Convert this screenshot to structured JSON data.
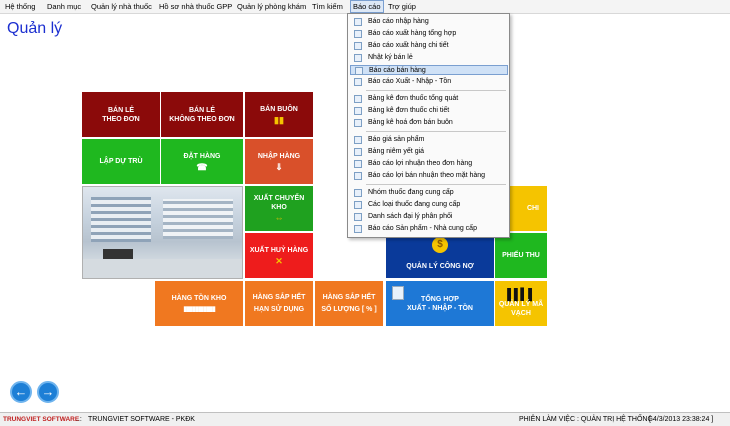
{
  "menu": {
    "items": [
      "Hệ thống",
      "Danh mục",
      "Quản lý nhà thuốc",
      "Hồ sơ nhà thuốc GPP",
      "Quản lý phòng khám",
      "Tìm kiếm",
      "Báo cáo",
      "Trợ giúp"
    ]
  },
  "page_title": "Quản lý",
  "tiles": {
    "ban_le_theo_don": "BÁN LẺ\nTHEO ĐƠN",
    "ban_le_khong_theo_don": "BÁN LẺ\nKHÔNG THEO ĐƠN",
    "ban_buon": "BÁN BUÔN",
    "lap_du_tru": "LẬP DỰ TRÙ",
    "dat_hang": "ĐẶT HÀNG",
    "nhap_hang": "NHẬP HÀNG",
    "xuat_chuyen_kho": "XUẤT CHUYỂN\nKHO",
    "xuat_huy_hang": "XUẤT HUỶ HÀNG",
    "quan_ly_cong_no": "QUẢN LÝ CÔNG NỢ",
    "phieu_thu": "PHIẾU THU",
    "phieu_chi": "CHI",
    "hang_ton_kho": "HÀNG TỒN KHO",
    "hang_sap_het_han": "HÀNG SẮP HẾT\nHẠN SỬ DỤNG",
    "hang_sap_het_so_luong": "HÀNG SẮP HẾT\nSỐ LƯỢNG [ % ]",
    "tong_hop": "TỔNG HỢP\nXUẤT - NHẬP - TỒN",
    "quan_ly_ma_vach": "QUẢN LÝ MÃ VẠCH"
  },
  "dropdown": {
    "items": [
      "Báo cáo nhập hàng",
      "Báo cáo xuất hàng tổng hợp",
      "Báo cáo xuất hàng chi tiết",
      "Nhật ký bán lẻ",
      "Báo cáo bán hàng",
      "Báo cáo Xuất - Nhập - Tồn",
      "Bảng kê đơn thuốc tổng quát",
      "Bảng kê đơn thuốc chi tiết",
      "Bảng kê hoá đơn bán buôn",
      "Báo giá sản phẩm",
      "Bảng niêm yết giá",
      "Báo cáo lợi nhuận theo đơn hàng",
      "Báo cáo lợi bán nhuận theo mặt hàng",
      "Nhóm thuốc đang cung cấp",
      "Các loại thuốc đang cung cấp",
      "Danh sách đại lý phân phối",
      "Báo cáo Sản phẩm - Nhà cung cấp"
    ],
    "highlighted": "Báo cáo bán hàng"
  },
  "status": {
    "brand": "TRUNGVIET SOFTWARE",
    "dots": "..:",
    "company": "TRUNGVIET SOFTWARE - PKĐK",
    "session": "PHIÊN LÀM VIỆC : QUẢN TRỊ HỆ THỐNG",
    "datetime": "[ 4/3/2013 23:38:24 ]"
  },
  "colors": {
    "dark_red": "#8b0a0a",
    "green": "#1fb81f",
    "orange_red": "#d9502a",
    "orange": "#f07820",
    "red": "#ee1c1c",
    "blue_dark": "#0a3a9a",
    "yellow": "#f5c400",
    "blue": "#1e78d6",
    "title_blue": "#1c2fd0"
  }
}
